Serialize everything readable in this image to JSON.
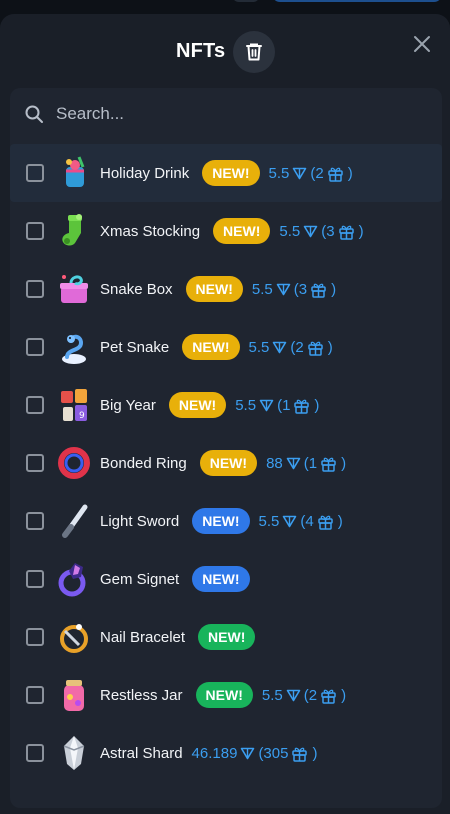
{
  "header": {
    "title": "NFTs"
  },
  "search": {
    "placeholder": "Search..."
  },
  "colors": {
    "accent": "#3b9ef0",
    "badge_yellow": "#e8b00a",
    "badge_blue": "#2f78e8",
    "badge_green": "#18b45b",
    "background": "#1a1f28"
  },
  "items": [
    {
      "name": "Holiday Drink",
      "badge": "NEW!",
      "badge_color": "yellow",
      "price": "5.5",
      "count": "(2",
      "close": ")",
      "icon": "holiday-drink-icon",
      "highlighted": true
    },
    {
      "name": "Xmas Stocking",
      "badge": "NEW!",
      "badge_color": "yellow",
      "price": "5.5",
      "count": "(3",
      "close": ")",
      "icon": "xmas-stocking-icon"
    },
    {
      "name": "Snake Box",
      "badge": "NEW!",
      "badge_color": "yellow",
      "price": "5.5",
      "count": "(3",
      "close": ")",
      "icon": "snake-box-icon"
    },
    {
      "name": "Pet Snake",
      "badge": "NEW!",
      "badge_color": "yellow",
      "price": "5.5",
      "count": "(2",
      "close": ")",
      "icon": "pet-snake-icon"
    },
    {
      "name": "Big Year",
      "badge": "NEW!",
      "badge_color": "yellow",
      "price": "5.5",
      "count": "(1",
      "close": ")",
      "icon": "big-year-icon"
    },
    {
      "name": "Bonded Ring",
      "badge": "NEW!",
      "badge_color": "yellow",
      "price": "88",
      "count": "(1",
      "close": ")",
      "icon": "bonded-ring-icon"
    },
    {
      "name": "Light Sword",
      "badge": "NEW!",
      "badge_color": "blue",
      "price": "5.5",
      "count": "(4",
      "close": ")",
      "icon": "light-sword-icon"
    },
    {
      "name": "Gem Signet",
      "badge": "NEW!",
      "badge_color": "blue",
      "icon": "gem-signet-icon"
    },
    {
      "name": "Nail Bracelet",
      "badge": "NEW!",
      "badge_color": "green",
      "icon": "nail-bracelet-icon"
    },
    {
      "name": "Restless Jar",
      "badge": "NEW!",
      "badge_color": "green",
      "price": "5.5",
      "count": "(2",
      "close": ")",
      "icon": "restless-jar-icon"
    },
    {
      "name": "Astral Shard",
      "price": "46.189",
      "count": "(305",
      "close": ")",
      "icon": "astral-shard-icon"
    }
  ]
}
